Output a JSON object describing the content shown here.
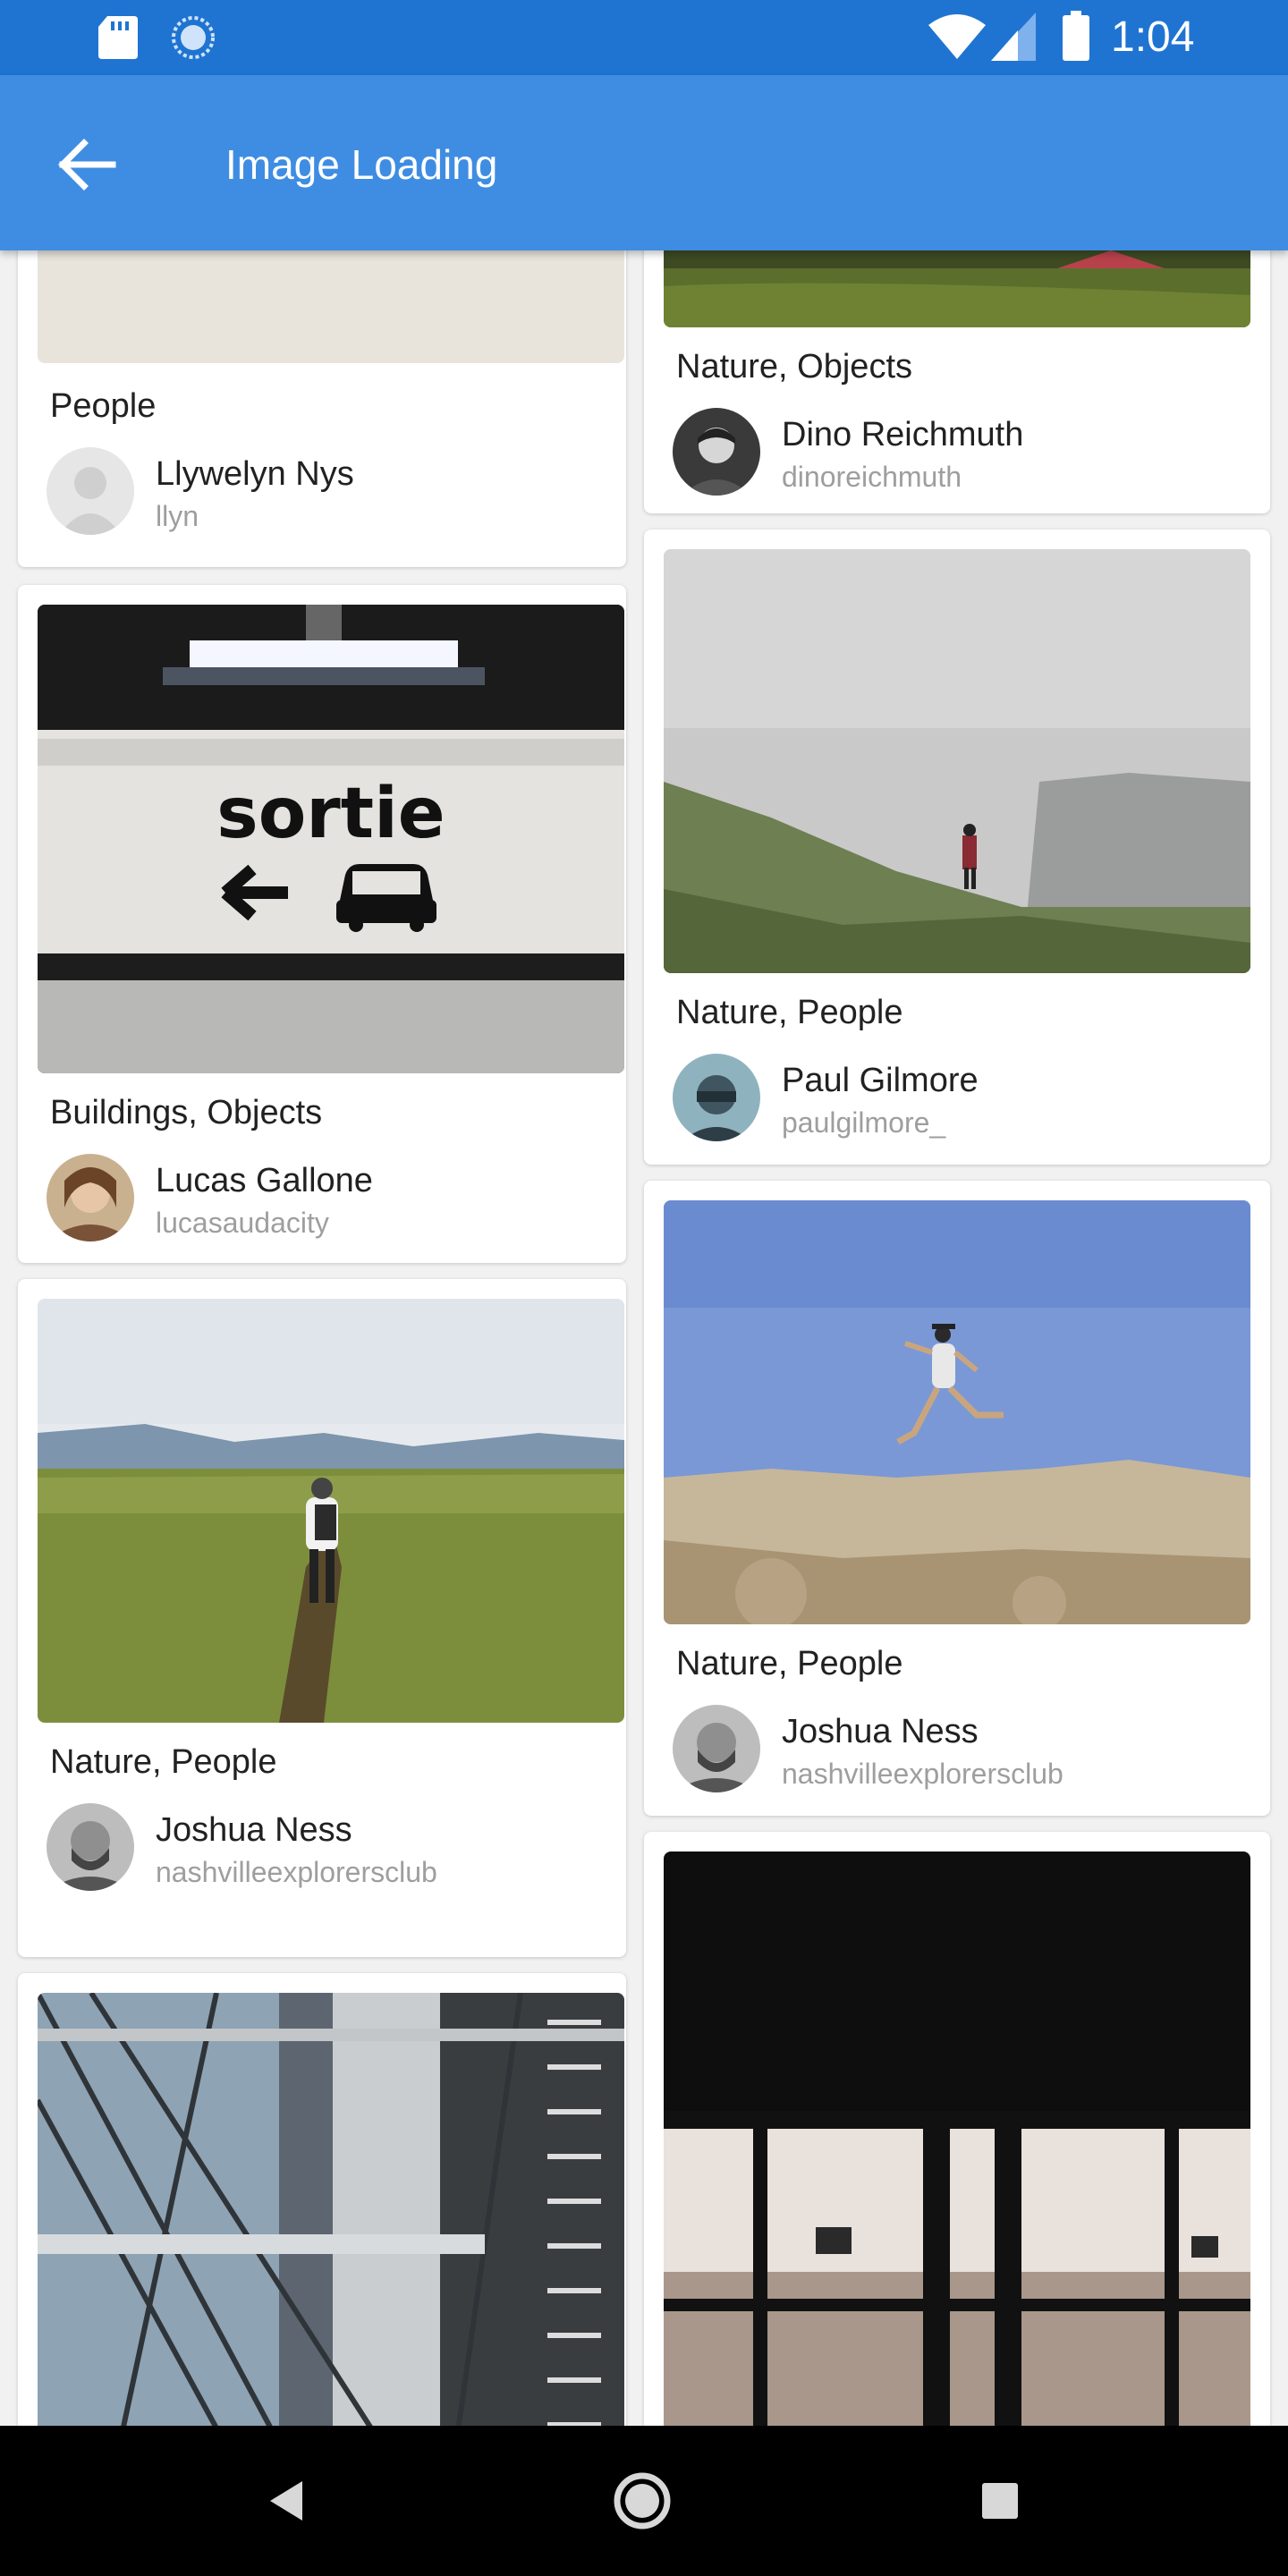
{
  "status_bar": {
    "time": "1:04",
    "icons": [
      "sd-card-icon",
      "sync-icon",
      "wifi-icon",
      "cell-signal-icon",
      "battery-icon"
    ]
  },
  "app_bar": {
    "title": "Image Loading",
    "back_icon": "arrow-back-icon"
  },
  "theme": {
    "status_bar_color": "#1f74d2",
    "app_bar_color": "#3f8de3",
    "background": "#f1f1f1"
  },
  "feed": {
    "left_column": [
      {
        "category": "People",
        "author_name": "Llywelyn Nys",
        "author_handle": "llyn",
        "image": "blank-placeholder"
      },
      {
        "category": "Buildings, Objects",
        "author_name": "Lucas Gallone",
        "author_handle": "lucasaudacity",
        "image": "parking-sortie-sign"
      },
      {
        "category": "Nature, People",
        "author_name": "Joshua Ness",
        "author_handle": "nashvilleexplorersclub",
        "image": "hiker-on-grassland"
      },
      {
        "category": "",
        "author_name": "",
        "author_handle": "",
        "image": "building-scaffold"
      }
    ],
    "right_column": [
      {
        "category": "Nature, Objects",
        "author_name": "Dino Reichmuth",
        "author_handle": "dinoreichmuth",
        "image": "grass-tent"
      },
      {
        "category": "Nature, People",
        "author_name": "Paul Gilmore",
        "author_handle": "paulgilmore_",
        "image": "foggy-mountain-person"
      },
      {
        "category": "Nature, People",
        "author_name": "Joshua Ness",
        "author_handle": "nashvilleexplorersclub",
        "image": "person-jumping-desert"
      },
      {
        "category": "",
        "author_name": "",
        "author_handle": "",
        "image": "window-silhouette"
      }
    ]
  },
  "photo_texts": {
    "sortie_sign": "sortie"
  },
  "nav_bar": {
    "buttons": [
      "back-nav-icon",
      "home-nav-icon",
      "recents-nav-icon"
    ]
  }
}
